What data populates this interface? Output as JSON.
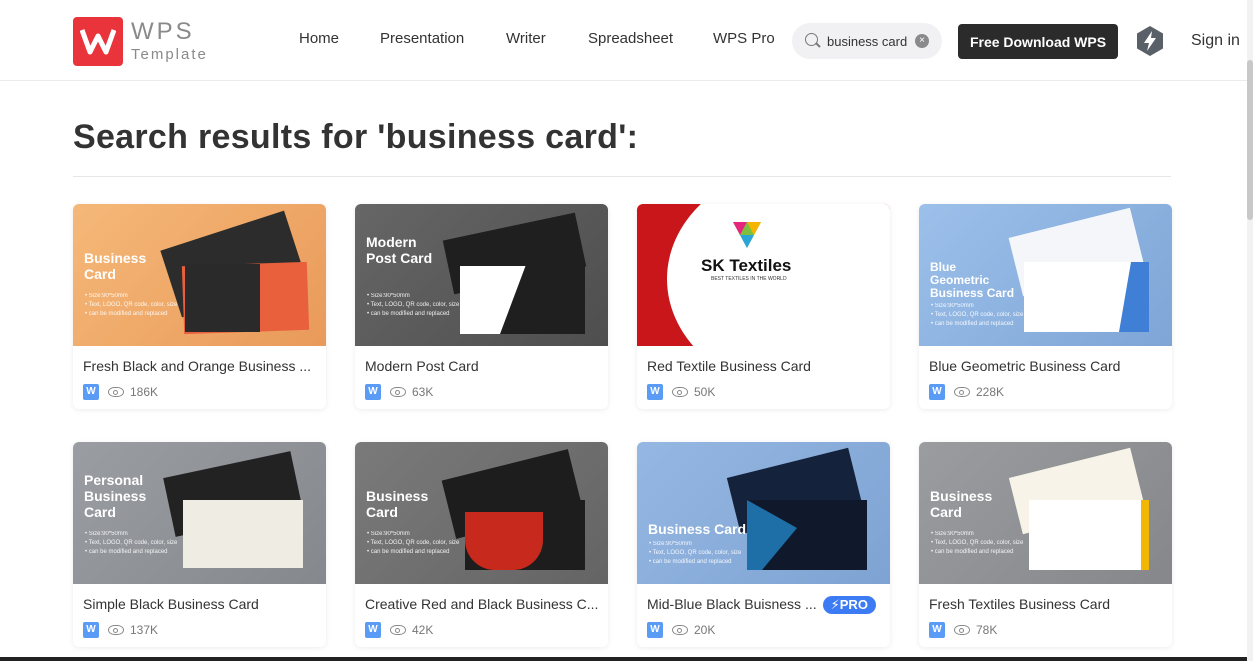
{
  "logo": {
    "wordmark": "WPS",
    "sub": "Template"
  },
  "nav": {
    "home": "Home",
    "presentation": "Presentation",
    "writer": "Writer",
    "spreadsheet": "Spreadsheet",
    "pro": "WPS Pro"
  },
  "search": {
    "value": "business card"
  },
  "download_label": "Free Download WPS",
  "signin_label": "Sign in",
  "page_title": "Search results for 'business card':",
  "cards": [
    {
      "name": "Fresh Black and Orange Business ...",
      "views": "186K",
      "thumb_title": "Business\nCard",
      "bg": "#f0a868"
    },
    {
      "name": "Modern Post Card",
      "views": "63K",
      "thumb_title": "Modern\nPost Card",
      "bg": "#5c5c5c"
    },
    {
      "name": "Red Textile Business Card",
      "views": "50K",
      "thumb_title": "SK Textiles",
      "thumb_sub": "BEST TEXTILES IN THE WORLD",
      "bg": "#ffffff"
    },
    {
      "name": "Blue Geometric Business Card",
      "views": "228K",
      "thumb_title": "Blue\nGeometric\nBusiness Card",
      "bg": "#8fb3e0"
    },
    {
      "name": "Simple Black Business Card",
      "views": "137K",
      "thumb_title": "Personal\nBusiness\nCard",
      "bg": "#8e9196"
    },
    {
      "name": "Creative Red and Black Business C...",
      "views": "42K",
      "thumb_title": "Business\nCard",
      "bg": "#727272"
    },
    {
      "name": "Mid-Blue Black Buisness ...",
      "views": "20K",
      "thumb_title": "Business Card",
      "bg": "#8aaedc",
      "pro": "PRO"
    },
    {
      "name": "Fresh Textiles Business Card",
      "views": "78K",
      "thumb_title": "Business\nCard",
      "bg": "#8c8f93"
    }
  ],
  "thumb_spec": "• Size:90*50mm\n• Text, LOGO, QR code, color, size\n• can be modified and replaced",
  "badge_letter": "W",
  "clear_symbol": "×"
}
